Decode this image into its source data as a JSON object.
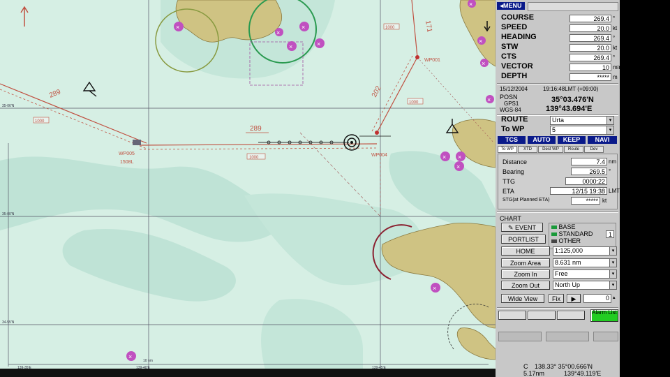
{
  "panel": {
    "menu_label": "MENU",
    "nav": [
      {
        "label": "COURSE",
        "value": "269.4",
        "unit": "°"
      },
      {
        "label": "SPEED",
        "value": "20.0",
        "unit": "kt"
      },
      {
        "label": "HEADING",
        "value": "269.4",
        "unit": "°"
      },
      {
        "label": "STW",
        "value": "20.0",
        "unit": "kt"
      },
      {
        "label": "CTS",
        "value": "269.4",
        "unit": "°"
      },
      {
        "label": "VECTOR",
        "value": "10",
        "unit": "min"
      },
      {
        "label": "DEPTH",
        "value": "*****",
        "unit": "m"
      }
    ],
    "date": "15/12/2004",
    "time": "19:16:48LMT (+09:00)",
    "posn_label": "POSN",
    "gps_label": "GPS1",
    "datum_label": "WGS-84",
    "lat": "35°03.476'N",
    "lon": "139°43.694'E",
    "route_label": "ROUTE",
    "route_value": "Urta",
    "towp_label": "To WP",
    "towp_value": "5",
    "modes": [
      "TCS",
      "AUTO",
      "KEEP",
      "NAVI"
    ],
    "tabs": [
      "To WP",
      "XTD",
      "Dest WP",
      "Route",
      "Dev"
    ],
    "wp_rows": [
      {
        "label": "Distance",
        "value": "7.4",
        "unit": "nm"
      },
      {
        "label": "Bearing",
        "value": "269.5",
        "unit": "°"
      },
      {
        "label": "TTG",
        "value": "0000:22",
        "unit": ""
      },
      {
        "label": "ETA",
        "value": "12/15 19:38",
        "unit": "LMT"
      },
      {
        "label": "STG(at Planned ETA)",
        "value": "*****",
        "unit": "kt"
      }
    ],
    "chart_label": "CHART",
    "event_btn": "EVENT",
    "portlist_btn": "PORTLIST",
    "levels": [
      "BASE",
      "STANDARD",
      "OTHER"
    ],
    "std_num": "1",
    "home_btn": "HOME",
    "scale_value": "1:125,000",
    "zoomarea_btn": "Zoom Area",
    "range_value": "8.631 nm",
    "zoomin_btn": "Zoom In",
    "motion_value": "Free",
    "zoomout_btn": "Zoom Out",
    "orient_value": "North Up",
    "wideview_btn": "Wide View",
    "fix_btn": "Fix",
    "fix_num": "0",
    "alarm_label": "Alarm List",
    "cursor_prefix": "C",
    "cursor_line1": "138.33° 35°00.666'N",
    "cursor_dist": "5.17nm",
    "cursor_line2": "139°49.119'E",
    "colors": {
      "panel": "#c8c8c8",
      "blue": "#0a1a8a",
      "alarm": "#22cc22"
    }
  },
  "chart": {
    "waypoints": {
      "wp001": "WP001",
      "wp004": "WP004",
      "wp005": "WP005",
      "wp005_b": "1508L"
    },
    "course_labels": {
      "top": "171",
      "mid": "202",
      "leg": "289",
      "left": "289"
    },
    "boxes": {
      "b1": "1000",
      "b2": "1000",
      "b3": "1000",
      "b4": "1000"
    },
    "lat_labels": {
      "l1": "35-06'N",
      "l2": "35-00'N",
      "l3": "34-55'N"
    },
    "lon_labels": {
      "m1": "139-35'E",
      "m2": "139-40'E",
      "m3": "139-45'E"
    },
    "scale_label": "10 nm",
    "colors": {
      "sea": "#d6efe4",
      "shallow": "#bfe3d6",
      "land": "#cfc383",
      "route": "#c05040"
    }
  }
}
